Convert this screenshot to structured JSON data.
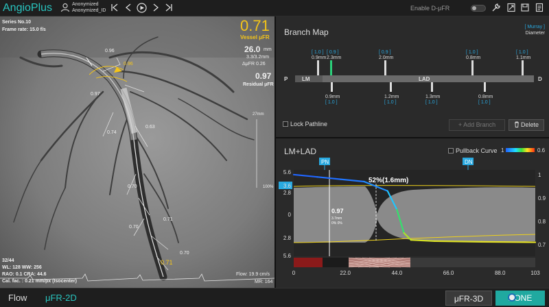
{
  "app": {
    "title": "AngioPlus"
  },
  "user": {
    "name": "Anonymized",
    "id": "Anonymized_ID"
  },
  "toolbar": {
    "enable_dufr_label": "Enable D-μFR"
  },
  "angio": {
    "series": "Series No.10",
    "frame_rate": "Frame rate: 15.0 f/s",
    "vessel_ufr_value": "0.71",
    "vessel_ufr_label": "Vessel μFR",
    "length_value": "26.0",
    "length_unit": "mm",
    "diam_ratio": "3.3/3.2mm",
    "delta_ufr": "ΔμFR  0.26",
    "residual_value": "0.97",
    "residual_label": "Residual μFR",
    "frame_counter": "32/44",
    "wl_ww": "WL: 128 WW: 256",
    "rao": "RAO: 0.1 CRA: 44.6",
    "cal": "Cal. fac. : 0.21 mm/px (Isocenter)",
    "flow": "Flow: 19.9 cm/s",
    "mr": "MR: 164",
    "side_27mm": "27mm",
    "side_100": "100%",
    "labels": [
      "0.96",
      "0.96",
      "0.97",
      "0.74",
      "0.63",
      "0.70",
      "0.70",
      "0.71",
      "0.70",
      "0.71"
    ]
  },
  "branch_map": {
    "title": "Branch Map",
    "murray": "[ Murray ]",
    "diameter": "Diameter",
    "p_label": "P",
    "d_label": "D",
    "lm_label": "LM",
    "lad_label": "LAD",
    "top": [
      {
        "ref": "[ 1.0 ]",
        "d": "0.9mm"
      },
      {
        "ref": "[ 0.9 ]",
        "d": "2.3mm"
      },
      {
        "ref": "[ 0.9 ]",
        "d": "2.0mm"
      },
      {
        "ref": "[ 1.0 ]",
        "d": "0.8mm"
      },
      {
        "ref": "[ 1.0 ]",
        "d": "1.1mm"
      }
    ],
    "bottom": [
      {
        "d": "0.9mm",
        "ref": "[ 1.0 ]"
      },
      {
        "d": "1.2mm",
        "ref": "[ 1.0 ]"
      },
      {
        "d": "1.3mm",
        "ref": "[ 1.0 ]"
      },
      {
        "d": "0.8mm",
        "ref": "[ 1.0 ]"
      }
    ],
    "lock_label": "Lock Pathline",
    "add_label": "+ Add Branch",
    "delete_label": "Delete"
  },
  "pullback": {
    "title": "LM+LAD",
    "curve_label": "Pullback Curve",
    "scale_min": "1",
    "scale_max": "0.6",
    "pn_label": "PN",
    "dn_label": "DN",
    "pct_label": "52%(1.6mm)",
    "cursor_value": "0.97",
    "cursor_len": "3.7mm",
    "cursor_pct": "0% 0%",
    "left_ticks": [
      "5.6",
      "3.6",
      "2.8",
      "0",
      "2.8",
      "5.6"
    ],
    "right_ticks": [
      "1",
      "0.9",
      "0.8",
      "0.7"
    ],
    "x_ticks": [
      "0",
      "22.0",
      "44.0",
      "66.0",
      "88.0",
      "103"
    ]
  },
  "chart_data": {
    "type": "line",
    "title": "LM+LAD",
    "xlabel": "",
    "ylabel": "",
    "xlim": [
      0,
      103
    ],
    "series": [
      {
        "name": "Pullback Curve",
        "x": [
          0,
          10,
          20,
          30,
          40,
          44,
          47,
          50,
          60,
          80,
          103
        ],
        "y": [
          1.0,
          0.99,
          0.98,
          0.97,
          0.93,
          0.85,
          0.75,
          0.72,
          0.715,
          0.712,
          0.71
        ]
      }
    ]
  },
  "bottom": {
    "flow_tab": "Flow",
    "ufr2d_tab": "μFR-2D",
    "ufr3d_btn": "μFR-3D",
    "done_btn": "DONE"
  },
  "colors": {
    "accent": "#29c5c0",
    "ufr_yellow": "#f5c518",
    "link_blue": "#29a9e0"
  }
}
